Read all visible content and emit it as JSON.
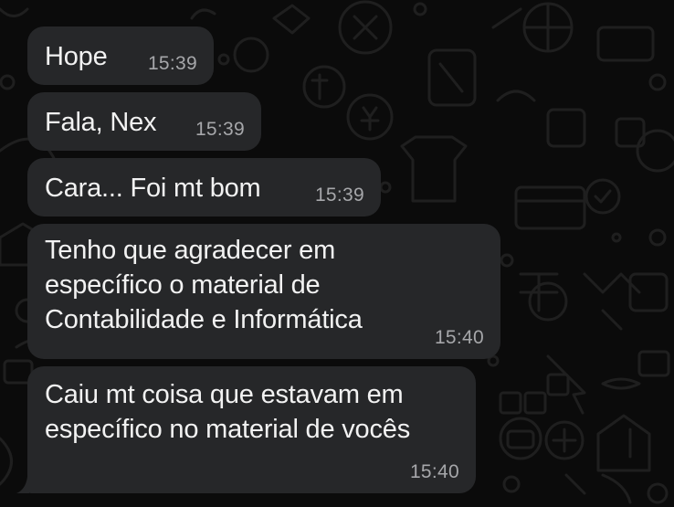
{
  "theme": {
    "background": "#0b0b0b",
    "bubble_color": "#262729",
    "text_color": "#f2f2f2",
    "time_color": "#a6a7aa",
    "pattern_color": "#1f1f1f"
  },
  "messages": [
    {
      "text": "Hope",
      "time": "15:39"
    },
    {
      "text": "Fala, Nex",
      "time": "15:39"
    },
    {
      "text": "Cara... Foi mt bom",
      "time": "15:39"
    },
    {
      "text": "Tenho que agradecer em\nespecífico o material de\nContabilidade e Informática",
      "time": "15:40"
    },
    {
      "text": "Caiu mt coisa que estavam em\nespecífico no material de vocês",
      "time": "15:40"
    }
  ]
}
